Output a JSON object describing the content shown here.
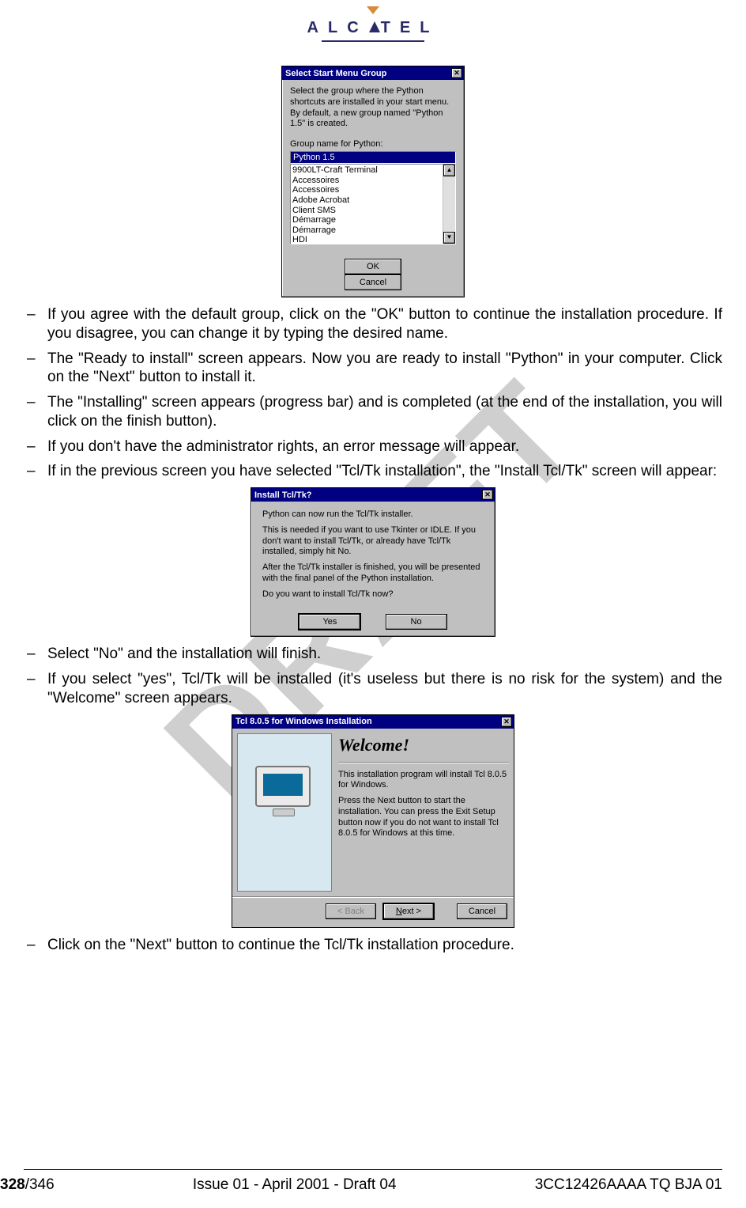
{
  "logo_text_before": "ALC",
  "logo_text_after": "TEL",
  "watermark": "DRAFT",
  "dialog1": {
    "title": "Select Start Menu Group",
    "desc": "Select the group where the Python shortcuts are installed in your start menu.  By default, a new group named \"Python 1.5\" is created.",
    "label": "Group name for Python:",
    "input_value": "Python 1.5",
    "list": [
      "9900LT-Craft Terminal",
      "Accessoires",
      "Accessoires",
      "Adobe Acrobat",
      "Client SMS",
      "Démarrage",
      "Démarrage",
      "HDI"
    ],
    "ok": "OK",
    "cancel": "Cancel"
  },
  "bul1": "If you agree with the default group, click on the \"OK\" button to continue the installation procedure. If you disagree, you can change it by typing the desired name.",
  "bul2": "The \"Ready to install\" screen appears. Now you are ready to install \"Python\" in your computer. Click on the \"Next\" button to install it.",
  "bul3": "The \"Installing\" screen appears (progress bar) and is completed (at the end of the installation, you will click on the finish button).",
  "bul4": "If you don't have the administrator rights, an error message will appear.",
  "bul5": "If in the previous screen you have selected \"Tcl/Tk installation\", the \"Install Tcl/Tk\" screen will appear:",
  "dialog2": {
    "title": "Install Tcl/Tk?",
    "p1": "Python can now run the Tcl/Tk installer.",
    "p2": "This is needed if you want to use Tkinter or IDLE. If you don't want to install Tcl/Tk, or already have Tcl/Tk installed, simply hit No.",
    "p3": "After the Tcl/Tk installer is finished, you will be presented with the final panel of the Python installation.",
    "p4": "Do you want to install Tcl/Tk now?",
    "yes": "Yes",
    "no": "No"
  },
  "bul6": "Select \"No\" and the installation will finish.",
  "bul7": "If you select \"yes\", Tcl/Tk will be installed (it's useless but there is no risk for the system) and the \"Welcome\" screen appears.",
  "dialog3": {
    "title": "Tcl 8.0.5 for Windows Installation",
    "welcome": "Welcome!",
    "p1": "This installation program will install Tcl 8.0.5 for Windows.",
    "p2": "Press the Next button to start the installation. You can press the Exit Setup button now if you do not want to install Tcl 8.0.5 for Windows at this time.",
    "back": "< Back",
    "next": "Next >",
    "cancel": "Cancel"
  },
  "bul8": "Click on the \"Next\" button to continue the Tcl/Tk installation procedure.",
  "footer": {
    "page_bold": "328",
    "page_rest": "/346",
    "center": "Issue 01 - April 2001 - Draft 04",
    "right": "3CC12426AAAA TQ BJA 01"
  }
}
